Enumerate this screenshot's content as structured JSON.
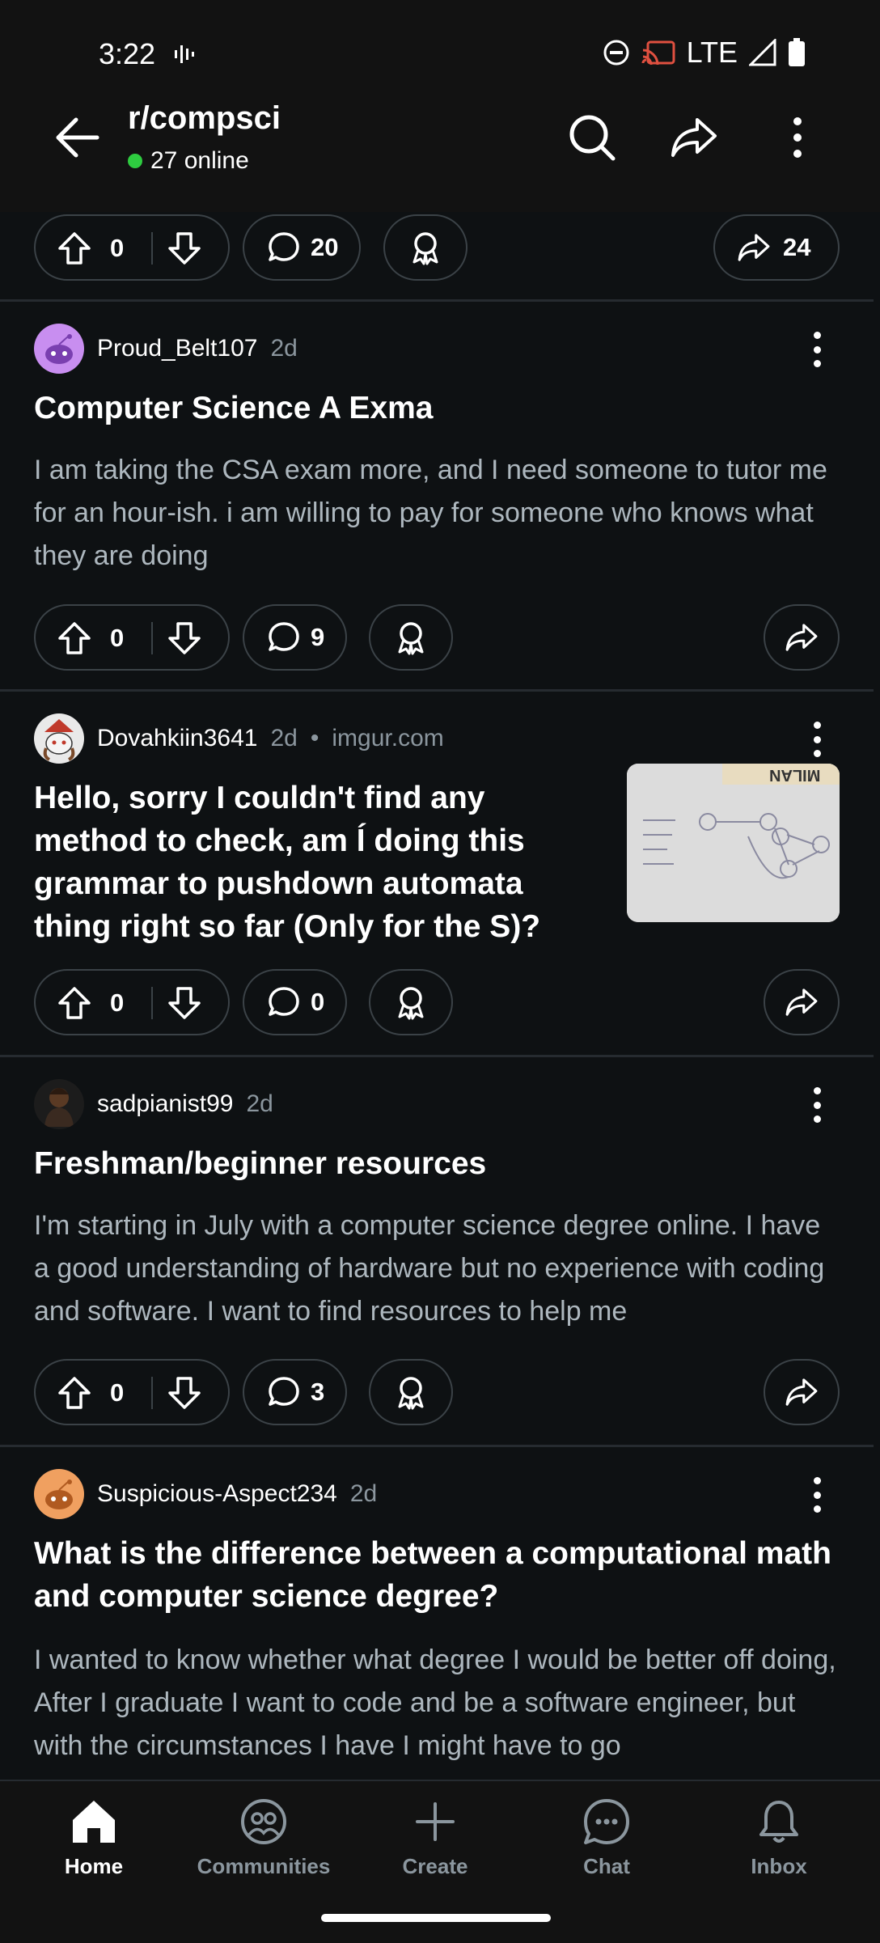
{
  "status": {
    "time": "3:22",
    "network": "LTE"
  },
  "header": {
    "title": "r/compsci",
    "online": "27 online"
  },
  "top_actions": {
    "votes": "0",
    "comments": "20",
    "shares": "24"
  },
  "posts": [
    {
      "author": "Proud_Belt107",
      "age": "2d",
      "domain": "",
      "title": "Computer Science A Exma",
      "body": "I am taking the CSA exam more, and I need someone to tutor me for an hour-ish. i am willing to pay for someone who knows what they are doing",
      "votes": "0",
      "comments": "9",
      "avatar_color": "#c88ef0"
    },
    {
      "author": "Dovahkiin3641",
      "age": "2d",
      "domain": "imgur.com",
      "title": "Hello, sorry I couldn't find any method to check, am Í doing this grammar to pushdown automata thing right so far (Only for the S)?",
      "body": "",
      "votes": "0",
      "comments": "0",
      "avatar_color": "#e9e9e9"
    },
    {
      "author": "sadpianist99",
      "age": "2d",
      "domain": "",
      "title": "Freshman/beginner resources",
      "body": "I'm starting in July with a computer science degree online. I have a good understanding of hardware but no experience with coding and software. I want to find resources to help me",
      "votes": "0",
      "comments": "3",
      "avatar_color": "#3a2a20"
    },
    {
      "author": "Suspicious-Aspect234",
      "age": "2d",
      "domain": "",
      "title": "What is the difference between a computational math and computer science degree?",
      "body": "I wanted to know whether what degree I would be better off doing, After I graduate I want to code and be a software engineer, but with the circumstances I have I might have to go",
      "votes": "0",
      "comments": "",
      "avatar_color": "#f0a060"
    }
  ],
  "thumbnail": {
    "caption_text": "MILAN"
  },
  "nav": {
    "home": "Home",
    "communities": "Communities",
    "create": "Create",
    "chat": "Chat",
    "inbox": "Inbox"
  },
  "colors": {
    "background": "#0e1113",
    "online_dot": "#2ecc40",
    "muted_text": "#8b969e"
  },
  "icons": [
    "back-arrow-icon",
    "search-icon",
    "share-icon",
    "more-vert-icon",
    "upvote-icon",
    "downvote-icon",
    "comment-icon",
    "award-icon",
    "home-icon",
    "communities-icon",
    "create-icon",
    "chat-icon",
    "inbox-icon"
  ]
}
